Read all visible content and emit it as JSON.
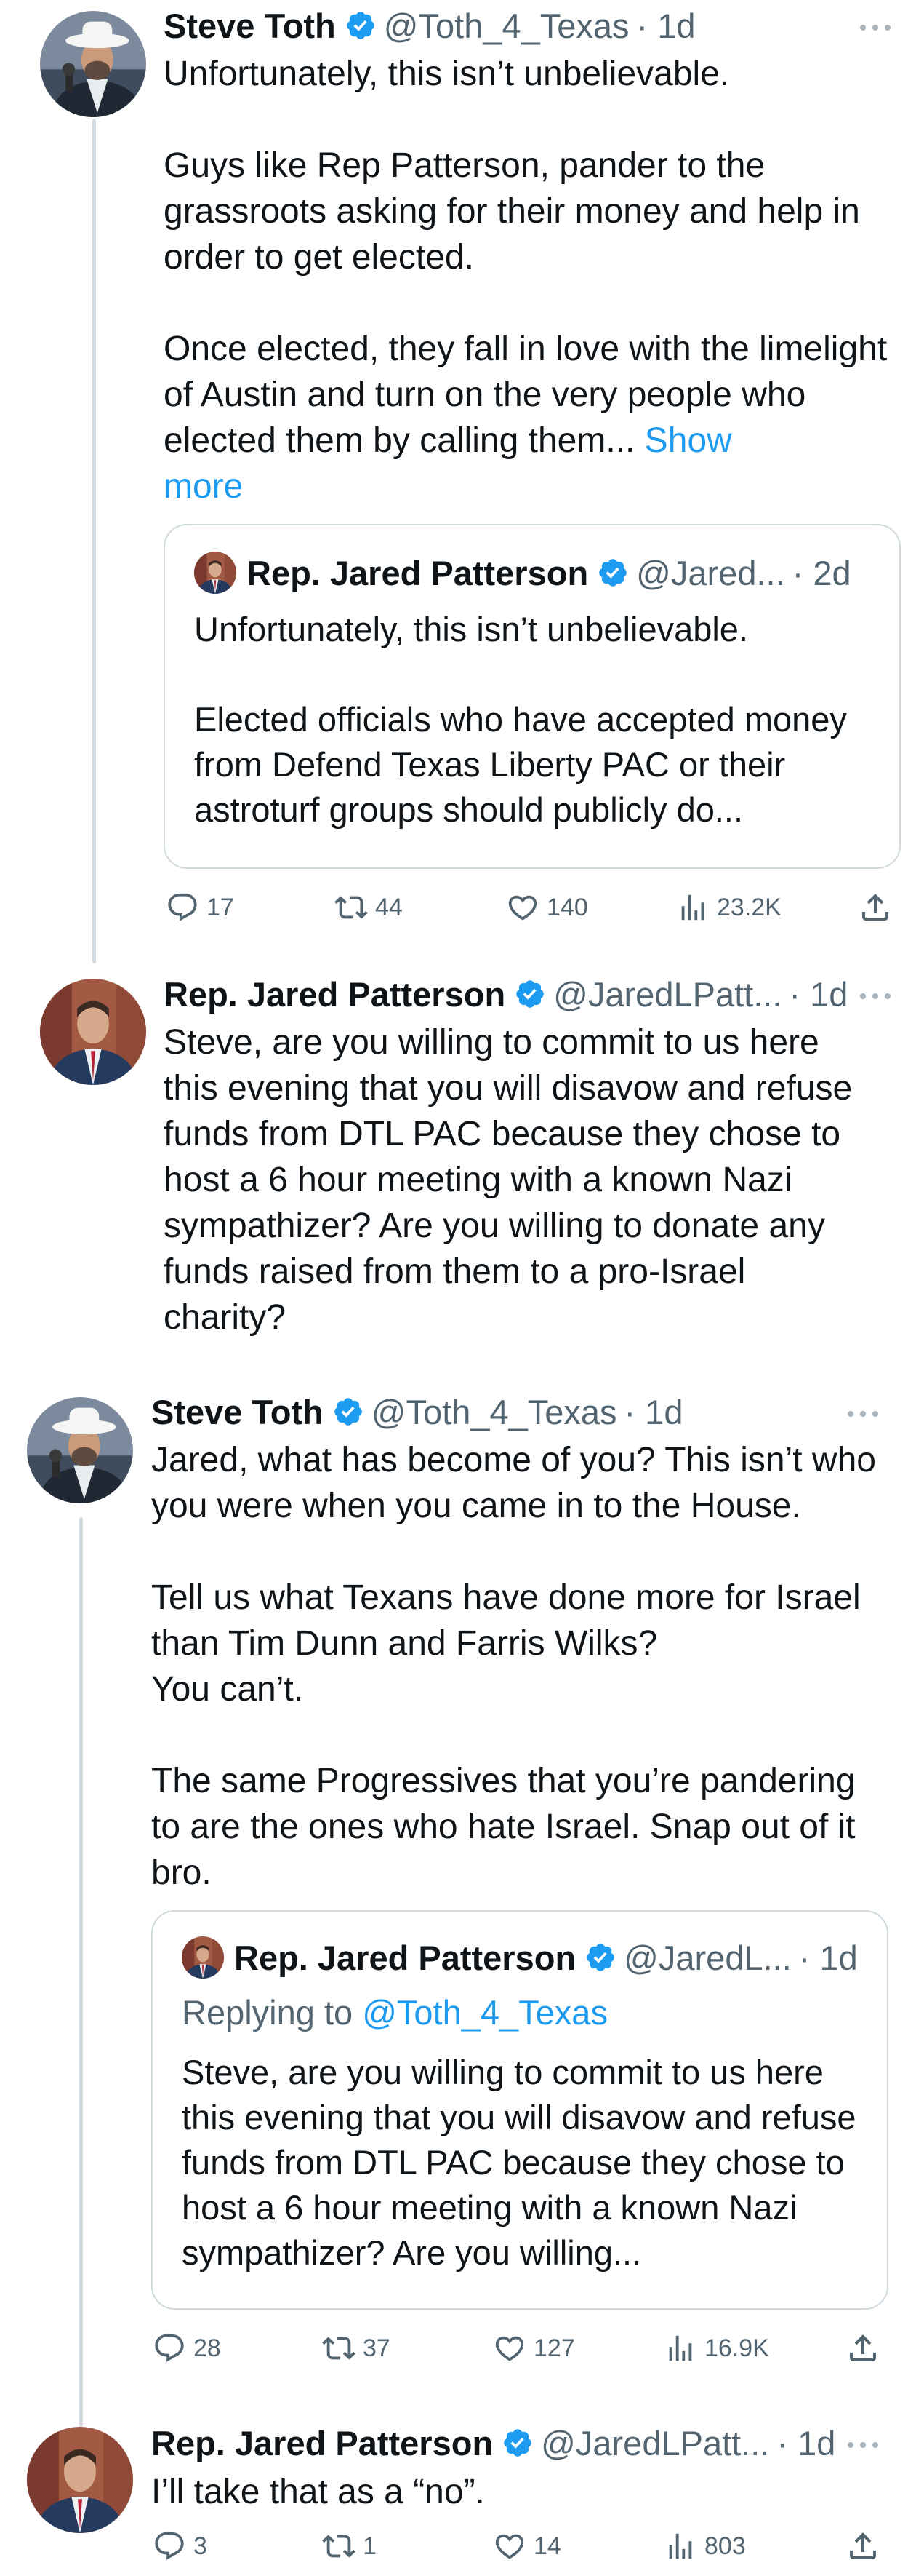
{
  "colors": {
    "accent": "#1d9bf0",
    "text": "#0f1419",
    "muted": "#536471",
    "border": "#cfd9de"
  },
  "tweets": [
    {
      "author": "Steve Toth",
      "handle": "@Toth_4_Texas",
      "time": "· 1d",
      "text": "Unfortunately, this isn’t unbelievable.\n\nGuys like Rep Patterson, pander to the grassroots asking for their money and help in order to get elected.\n\nOnce elected, they fall in love with the limelight of Austin and turn on the very people who elected them by calling them...",
      "show_more": "Show\nmore",
      "quote": {
        "author": "Rep. Jared Patterson",
        "handle": "@Jared...",
        "time": "· 2d",
        "text": "Unfortunately, this isn’t unbelievable.\n\nElected officials who have accepted money from Defend Texas Liberty PAC or their astroturf groups should publicly do..."
      },
      "stats": {
        "replies": "17",
        "reposts": "44",
        "likes": "140",
        "views": "23.2K"
      }
    },
    {
      "author": "Rep. Jared Patterson",
      "handle": "@JaredLPatt...",
      "time": "· 1d",
      "text": "Steve, are you willing to commit to us here this evening that you will disavow and refuse funds from DTL PAC because they chose to host a 6 hour meeting with a known Nazi sympathizer? Are you willing to donate any funds raised from them to a pro-Israel charity?"
    },
    {
      "author": "Steve Toth",
      "handle": "@Toth_4_Texas",
      "time": "· 1d",
      "text": "Jared, what has become of you?  This isn’t who you were when you came in to the House.\n\nTell us what Texans have done more for Israel than Tim Dunn and Farris Wilks?\nYou can’t.\n\nThe same Progressives that you’re pandering to are the ones who hate Israel. Snap out of it bro.",
      "quote": {
        "author": "Rep. Jared Patterson",
        "handle": "@JaredL...",
        "time": "· 1d",
        "replying_prefix": "Replying to",
        "replying_handle": "@Toth_4_Texas",
        "text": "Steve, are you willing to commit to us here this evening that you will disavow and refuse funds from DTL PAC because they chose to host a 6 hour meeting with a known Nazi sympathizer? Are you willing..."
      },
      "stats": {
        "replies": "28",
        "reposts": "37",
        "likes": "127",
        "views": "16.9K"
      }
    },
    {
      "author": "Rep. Jared Patterson",
      "handle": "@JaredLPatt...",
      "time": "· 1d",
      "text": "I’ll take that as a “no”.",
      "stats": {
        "replies": "3",
        "reposts": "1",
        "likes": "14",
        "views": "803"
      }
    }
  ]
}
